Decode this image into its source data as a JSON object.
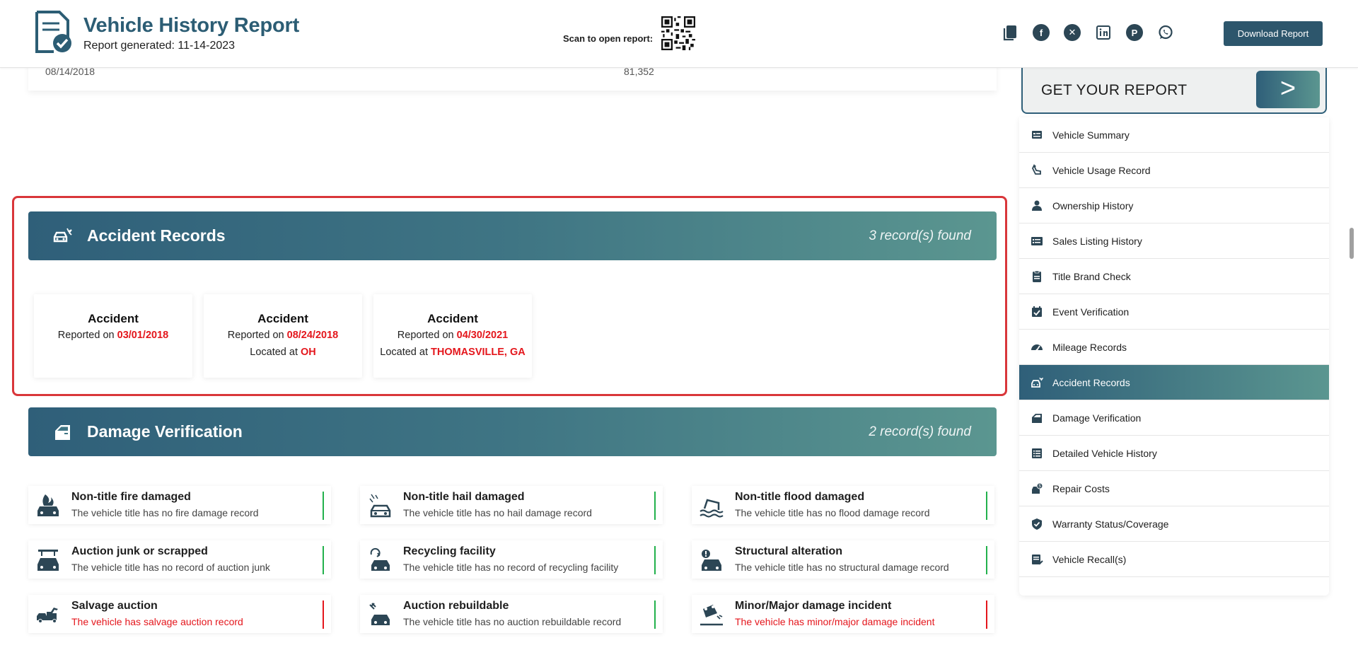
{
  "header": {
    "title": "Vehicle History Report",
    "generated": "Report generated: 11-14-2023",
    "scan_label": "Scan to open report:",
    "socials": [
      "copy-icon",
      "facebook-icon",
      "x-icon",
      "linkedin-icon",
      "pinterest-icon",
      "whatsapp-icon"
    ],
    "download_label": "Download Report"
  },
  "previous_table": {
    "date": "08/14/2018",
    "mileage": "81,352"
  },
  "accident_section": {
    "title": "Accident Records",
    "count": "3 record(s) found",
    "cards": [
      {
        "title": "Accident",
        "reported_prefix": "Reported on ",
        "date": "03/01/2018",
        "located_prefix": "",
        "location": ""
      },
      {
        "title": "Accident",
        "reported_prefix": "Reported on ",
        "date": "08/24/2018",
        "located_prefix": "Located at ",
        "location": "OH"
      },
      {
        "title": "Accident",
        "reported_prefix": "Reported on ",
        "date": "04/30/2021",
        "located_prefix": "Located at ",
        "location": "THOMASVILLE, GA"
      }
    ]
  },
  "damage_section": {
    "title": "Damage Verification",
    "count": "2 record(s) found",
    "items": [
      {
        "title": "Non-title fire damaged",
        "desc": "The vehicle title has no fire damage record",
        "status": "ok"
      },
      {
        "title": "Non-title hail damaged",
        "desc": "The vehicle title has no hail damage record",
        "status": "ok"
      },
      {
        "title": "Non-title flood damaged",
        "desc": "The vehicle title has no flood damage record",
        "status": "ok"
      },
      {
        "title": "Auction junk or scrapped",
        "desc": "The vehicle title has no record of auction junk",
        "status": "ok"
      },
      {
        "title": "Recycling facility",
        "desc": "The vehicle title has no record of recycling facility",
        "status": "ok"
      },
      {
        "title": "Structural alteration",
        "desc": "The vehicle title has no structural damage record",
        "status": "ok"
      },
      {
        "title": "Salvage auction",
        "desc": "The vehicle has salvage auction record",
        "status": "bad"
      },
      {
        "title": "Auction rebuildable",
        "desc": "The vehicle title has no auction rebuildable record",
        "status": "ok"
      },
      {
        "title": "Minor/Major damage incident",
        "desc": "The vehicle has minor/major damage incident",
        "status": "bad"
      }
    ]
  },
  "sidebar": {
    "cta_label": "GET YOUR REPORT",
    "cta_arrow": ">",
    "items": [
      {
        "label": "Vehicle Summary",
        "icon": "summary-icon"
      },
      {
        "label": "Vehicle Usage Record",
        "icon": "usage-icon"
      },
      {
        "label": "Ownership History",
        "icon": "person-icon"
      },
      {
        "label": "Sales Listing History",
        "icon": "listing-icon"
      },
      {
        "label": "Title Brand Check",
        "icon": "clipboard-icon"
      },
      {
        "label": "Event Verification",
        "icon": "calendar-check-icon"
      },
      {
        "label": "Mileage Records",
        "icon": "speedometer-icon"
      },
      {
        "label": "Accident Records",
        "icon": "car-crash-icon",
        "active": true
      },
      {
        "label": "Damage Verification",
        "icon": "car-door-icon"
      },
      {
        "label": "Detailed Vehicle History",
        "icon": "list-icon"
      },
      {
        "label": "Repair Costs",
        "icon": "repair-icon"
      },
      {
        "label": "Warranty Status/Coverage",
        "icon": "shield-check-icon"
      },
      {
        "label": "Vehicle Recall(s)",
        "icon": "recall-icon"
      }
    ]
  },
  "colors": {
    "brand": "#2c5d74",
    "gradient_start": "#2f5f79",
    "gradient_end": "#5b9690",
    "alert_red": "#e4161c",
    "ok_green": "#22b14c"
  }
}
